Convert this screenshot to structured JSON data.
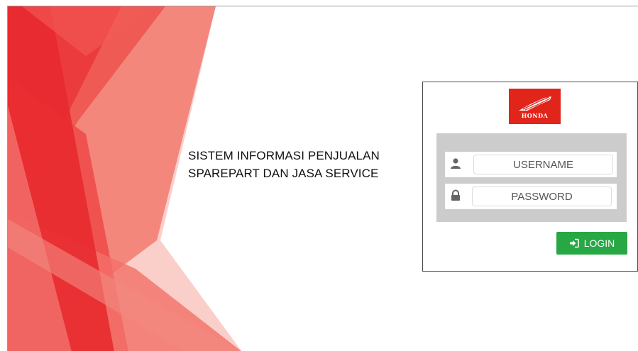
{
  "app": {
    "title_line1": "SISTEM INFORMASI PENJUALAN",
    "title_line2": "SPAREPART DAN JASA SERVICE"
  },
  "logo": {
    "text": "HONDA",
    "icon": "honda-wing-logo",
    "color": "#e1251b"
  },
  "form": {
    "username_placeholder": "USERNAME",
    "password_placeholder": "PASSWORD",
    "username_icon": "user-icon",
    "password_icon": "lock-icon",
    "login_label": "LOGIN",
    "login_icon": "sign-in-icon",
    "login_color": "#28a745"
  },
  "colors": {
    "accent_red": "#ed2f32",
    "panel_gray": "#cccccc"
  }
}
